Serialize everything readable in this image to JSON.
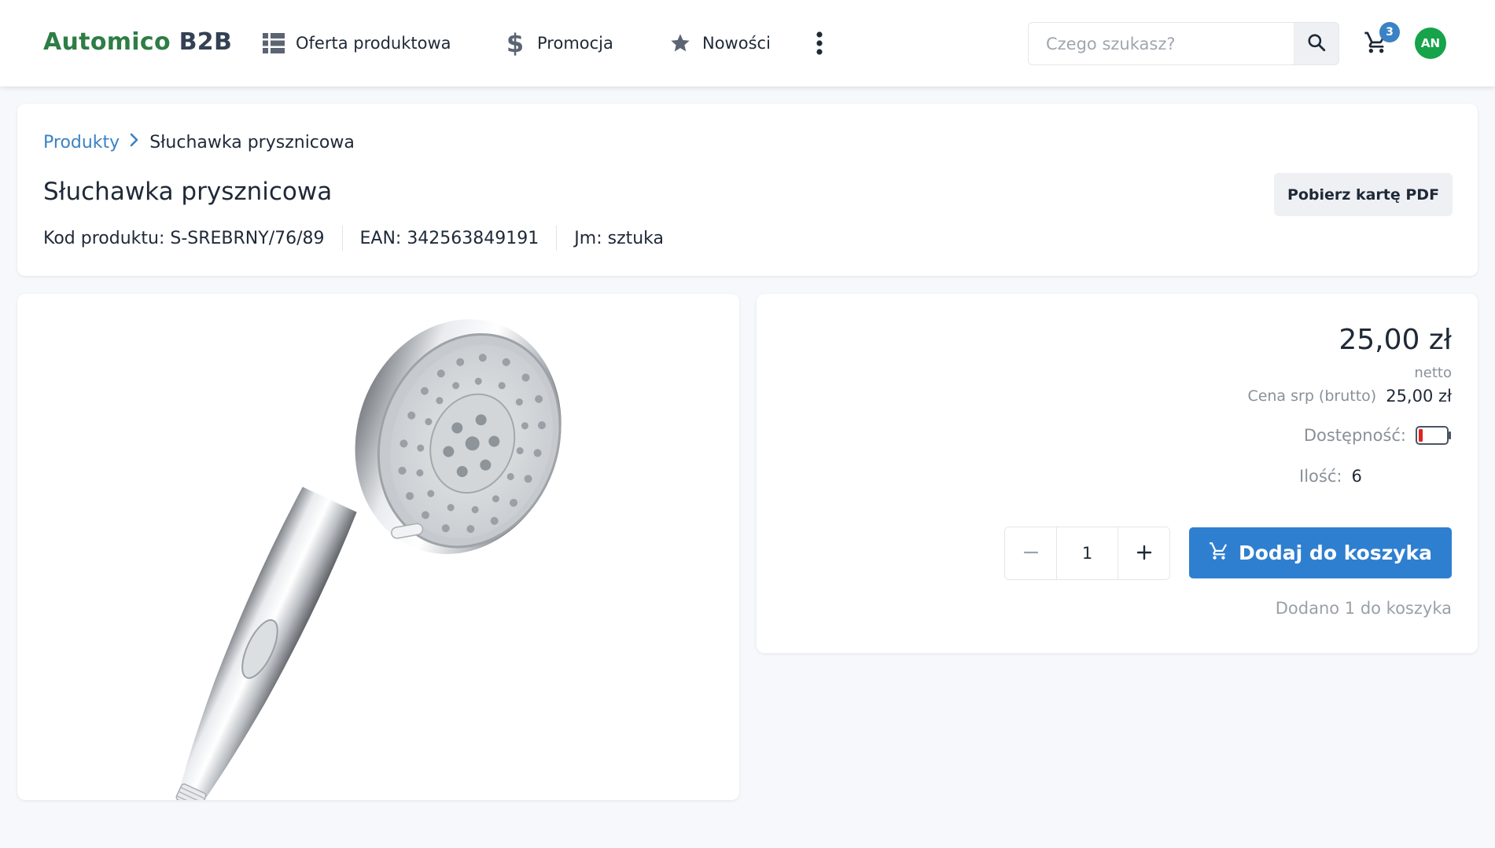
{
  "header": {
    "brand_main": "Automico",
    "brand_suffix": "B2B",
    "nav": [
      {
        "label": "Oferta produktowa",
        "icon": "grid-list-icon"
      },
      {
        "label": "Promocja",
        "icon": "dollar-icon"
      },
      {
        "label": "Nowości",
        "icon": "star-icon"
      }
    ],
    "more_icon": "kebab-menu-icon",
    "search_placeholder": "Czego szukasz?",
    "cart_count": "3",
    "avatar_initials": "AN"
  },
  "product": {
    "breadcrumb": {
      "root": "Produkty",
      "current": "Słuchawka prysznicowa"
    },
    "title": "Słuchawka prysznicowa",
    "code": "Kod produktu: S-SREBRNY/76/89",
    "ean": "EAN: 342563849191",
    "unit": "Jm: sztuka",
    "pdf_button": "Pobierz kartę PDF"
  },
  "purchase": {
    "price": "25,00 zł",
    "price_type": "netto",
    "srp_label": "Cena srp (brutto)",
    "srp_value": "25,00 zł",
    "availability_label": "Dostępność:",
    "availability_level": 0.15,
    "availability_color": "#dc2626",
    "quantity_label": "Ilość:",
    "quantity_value": "6",
    "stepper_value": "1",
    "add_button": "Dodaj do koszyka",
    "added_note": "Dodano 1 do koszyka"
  },
  "colors": {
    "brand_green": "#2e7d45",
    "primary_blue": "#2f7fd0",
    "link_blue": "#3b82c4",
    "avatar_green": "#16a34a"
  }
}
